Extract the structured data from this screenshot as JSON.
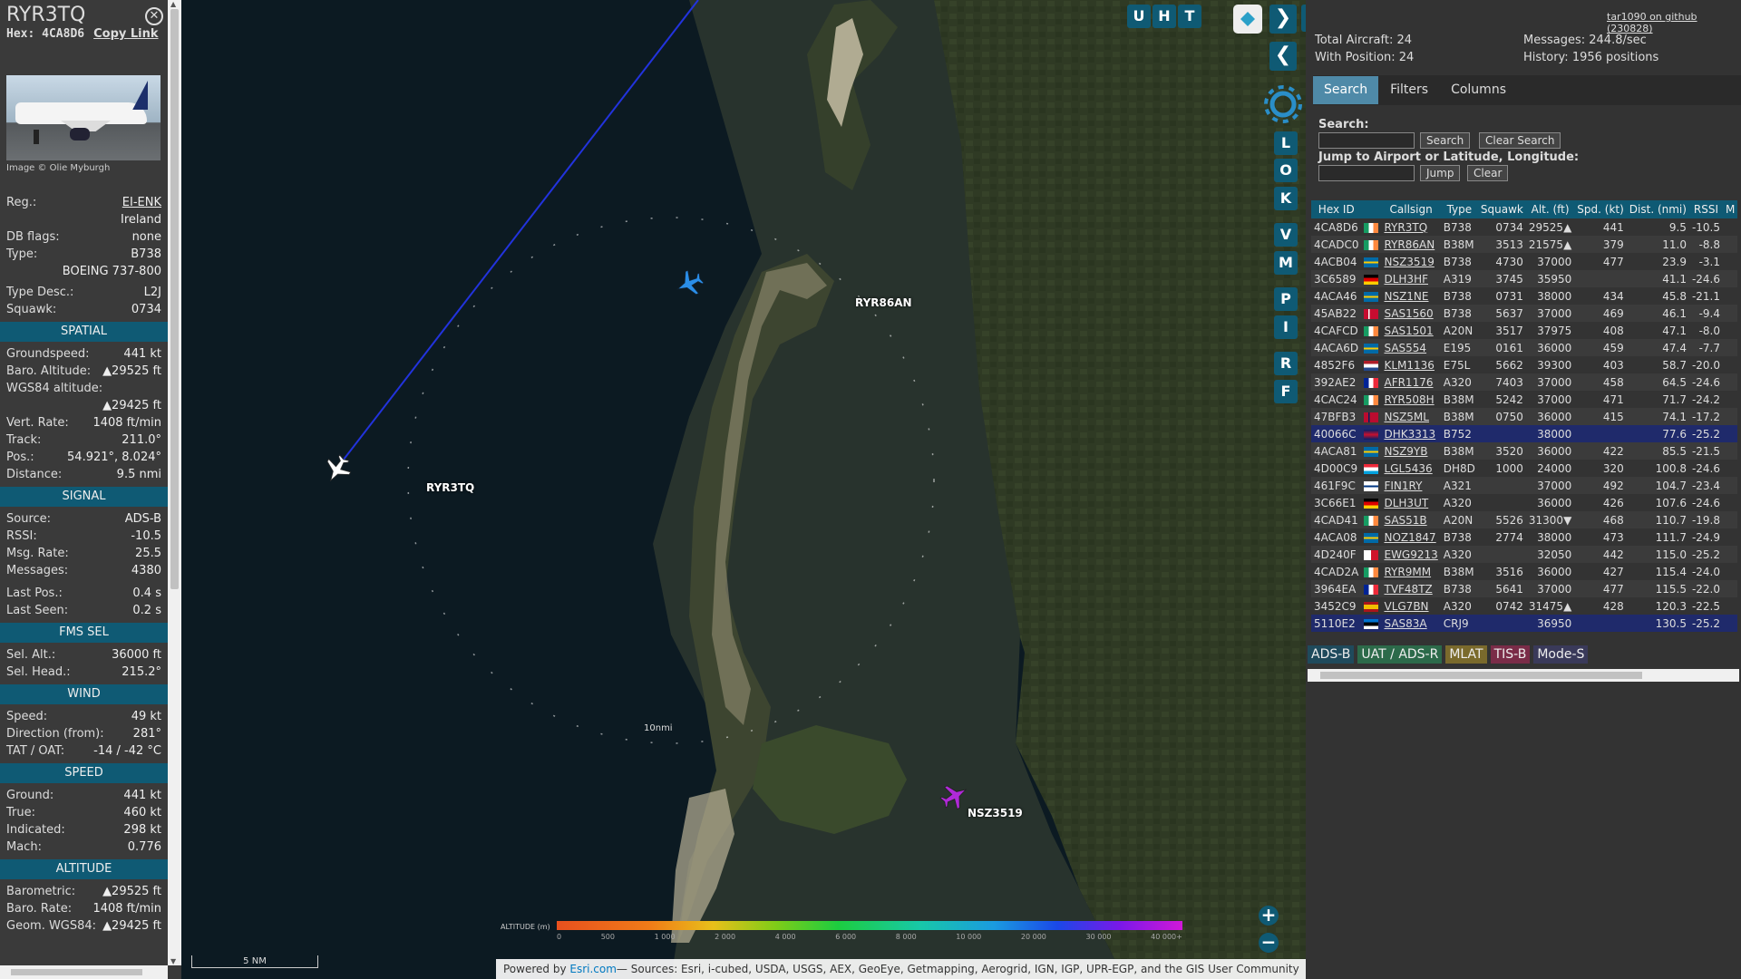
{
  "infoblock": {
    "callsign": "RYR3TQ",
    "close_icon": "close-icon",
    "hex_label": "Hex:",
    "hex": "4CA8D6",
    "copy_link": "Copy Link",
    "image_credit": "Image © Olie Myburgh",
    "reg_label": "Reg.:",
    "reg": "EI-ENK",
    "country": "Ireland",
    "dbflags_label": "DB flags:",
    "dbflags": "none",
    "type_label": "Type:",
    "type": "B738",
    "type_full": "BOEING 737-800",
    "typedesc_label": "Type Desc.:",
    "typedesc": "L2J",
    "squawk_label": "Squawk:",
    "squawk": "0734",
    "spatial_header": "SPATIAL",
    "gs_label": "Groundspeed:",
    "gs": "441 kt",
    "baro_label": "Baro. Altitude:",
    "baro": "▲29525 ft",
    "wgs_label": "WGS84 altitude:",
    "wgs": "▲29425 ft",
    "vr_label": "Vert. Rate:",
    "vr": "1408 ft/min",
    "track_label": "Track:",
    "track": "211.0°",
    "pos_label": "Pos.:",
    "pos": "54.921°, 8.024°",
    "dist_label": "Distance:",
    "dist": "9.5 nmi",
    "signal_header": "SIGNAL",
    "source_label": "Source:",
    "source": "ADS-B",
    "rssi_label": "RSSI:",
    "rssi": "-10.5",
    "msgrate_label": "Msg. Rate:",
    "msgrate": "25.5",
    "messages_label": "Messages:",
    "messages": "4380",
    "lastpos_label": "Last Pos.:",
    "lastpos": "0.4 s",
    "lastseen_label": "Last Seen:",
    "lastseen": "0.2 s",
    "fms_header": "FMS SEL",
    "selalt_label": "Sel. Alt.:",
    "selalt": "36000 ft",
    "selhead_label": "Sel. Head.:",
    "selhead": "215.2°",
    "wind_header": "WIND",
    "wspeed_label": "Speed:",
    "wspeed": "49 kt",
    "wdir_label": "Direction (from):",
    "wdir": "281°",
    "tat_label": "TAT / OAT:",
    "tat": "-14 / -42 °C",
    "speed_header": "SPEED",
    "ground_label": "Ground:",
    "ground": "441 kt",
    "true_label": "True:",
    "true": "460 kt",
    "ind_label": "Indicated:",
    "ind": "298 kt",
    "mach_label": "Mach:",
    "mach": "0.776",
    "alt_header": "ALTITUDE",
    "balt_label": "Barometric:",
    "balt": "▲29525 ft",
    "brate_label": "Baro. Rate:",
    "brate": "1408 ft/min",
    "geom_label": "Geom. WGS84:",
    "geom": "▲29425 ft"
  },
  "map": {
    "buttons_top": [
      "U",
      "H",
      "T"
    ],
    "side_buttons": [
      "L",
      "O",
      "K",
      "V",
      "M",
      "P",
      "I",
      "R",
      "F"
    ],
    "aircraft": [
      {
        "label": "RYR3TQ",
        "color": "#ffffff",
        "icon": "airplane-icon"
      },
      {
        "label": "RYR86AN",
        "color": "#2a8ee8",
        "icon": "airplane-icon"
      },
      {
        "label": "NSZ3519",
        "color": "#b02ad8",
        "icon": "airplane-icon"
      }
    ],
    "range_ring_label": "10nmi",
    "scale": "5 NM",
    "altitude_legend": {
      "title": "ALTITUDE (m)",
      "ticks": [
        "0",
        "500",
        "1 000",
        "2 000",
        "4 000",
        "6 000",
        "8 000",
        "10 000",
        "20 000",
        "30 000",
        "40 000+"
      ]
    },
    "attribution_prefix": "Powered by ",
    "attribution_link": "Esri.com",
    "attribution_rest": "— Sources: Esri, i-cubed, USDA, USGS, AEX, GeoEye, Getmapping, Aerogrid, IGN, IGP, UPR-EGP, and the GIS User Community",
    "zoom_in": "+",
    "zoom_out": "−"
  },
  "sidebar": {
    "github": "tar1090 on github (230828)",
    "total_aircraft": "Total Aircraft: 24",
    "with_position": "With Position: 24",
    "messages": "Messages: 244.8/sec",
    "history": "History: 1956 positions",
    "tabs": [
      "Search",
      "Filters",
      "Columns"
    ],
    "search_label": "Search:",
    "search_btn": "Search",
    "clear_search_btn": "Clear Search",
    "jump_label": "Jump to Airport or Latitude, Longitude:",
    "jump_btn": "Jump",
    "clear_btn": "Clear",
    "columns": [
      "Hex ID",
      "",
      "Callsign",
      "Type",
      "Squawk",
      "Alt. (ft)",
      "Spd. (kt)",
      "Dist. (nmi)",
      "RSSI",
      "M"
    ],
    "rows": [
      [
        "4CA8D6",
        "ie",
        "RYR3TQ",
        "B738",
        "0734",
        "29525▲",
        "441",
        "9.5",
        "-10.5"
      ],
      [
        "4CADC0",
        "ie",
        "RYR86AN",
        "B38M",
        "3513",
        "21575▲",
        "379",
        "11.0",
        "-8.8"
      ],
      [
        "4ACB04",
        "se",
        "NSZ3519",
        "B738",
        "4730",
        "37000",
        "477",
        "23.9",
        "-3.1"
      ],
      [
        "3C6589",
        "de",
        "DLH3HF",
        "A319",
        "3745",
        "35950",
        "",
        "41.1",
        "-24.6"
      ],
      [
        "4ACA46",
        "se",
        "NSZ1NE",
        "B738",
        "0731",
        "38000",
        "434",
        "45.8",
        "-21.1"
      ],
      [
        "45AB22",
        "dk",
        "SAS1560",
        "B738",
        "5637",
        "37000",
        "469",
        "46.1",
        "-9.4"
      ],
      [
        "4CAFCD",
        "ie",
        "SAS1501",
        "A20N",
        "3517",
        "37975",
        "408",
        "47.1",
        "-8.0"
      ],
      [
        "4ACA6D",
        "se",
        "SAS554",
        "E195",
        "0161",
        "36000",
        "459",
        "47.4",
        "-7.7"
      ],
      [
        "4852F6",
        "nl",
        "KLM1136",
        "E75L",
        "5662",
        "39300",
        "403",
        "58.7",
        "-20.0"
      ],
      [
        "392AE2",
        "fr",
        "AFR1176",
        "A320",
        "7403",
        "37000",
        "458",
        "64.5",
        "-24.6"
      ],
      [
        "4CAC24",
        "ie",
        "RYR508H",
        "B38M",
        "5242",
        "37000",
        "471",
        "71.7",
        "-24.2"
      ],
      [
        "47BFB3",
        "no",
        "NSZ5ML",
        "B38M",
        "0750",
        "36000",
        "415",
        "74.1",
        "-17.2"
      ],
      [
        "40066C",
        "gb",
        "DHK3313",
        "B752",
        "",
        "38000",
        "",
        "77.6",
        "-25.2"
      ],
      [
        "4ACA81",
        "se",
        "NSZ9YB",
        "B38M",
        "3520",
        "36000",
        "422",
        "85.5",
        "-21.5"
      ],
      [
        "4D00C9",
        "lu",
        "LGL5436",
        "DH8D",
        "1000",
        "24000",
        "320",
        "100.8",
        "-24.6"
      ],
      [
        "461F9C",
        "fi",
        "FIN1RY",
        "A321",
        "",
        "37000",
        "492",
        "104.7",
        "-23.4"
      ],
      [
        "3C66E1",
        "de",
        "DLH3UT",
        "A320",
        "",
        "36000",
        "426",
        "107.6",
        "-24.6"
      ],
      [
        "4CAD41",
        "ie",
        "SAS51B",
        "A20N",
        "5526",
        "31300▼",
        "468",
        "110.7",
        "-19.8"
      ],
      [
        "4ACA08",
        "se",
        "NOZ1847",
        "B738",
        "2774",
        "38000",
        "473",
        "111.7",
        "-24.9"
      ],
      [
        "4D240F",
        "mt",
        "EWG9213",
        "A320",
        "",
        "32050",
        "442",
        "115.0",
        "-25.2"
      ],
      [
        "4CAD2A",
        "ie",
        "RYR9MM",
        "B38M",
        "3516",
        "36000",
        "427",
        "115.4",
        "-24.0"
      ],
      [
        "3964EA",
        "fr",
        "TVF48TZ",
        "B738",
        "5641",
        "37000",
        "477",
        "115.5",
        "-22.0"
      ],
      [
        "3452C9",
        "es",
        "VLG7BN",
        "A320",
        "0742",
        "31475▲",
        "428",
        "120.3",
        "-22.5"
      ],
      [
        "5110E2",
        "ee",
        "SAS83A",
        "CRJ9",
        "",
        "36950",
        "",
        "130.5",
        "-25.2"
      ]
    ],
    "legend": [
      "ADS-B",
      "UAT / ADS-R",
      "MLAT",
      "TIS-B",
      "Mode-S"
    ]
  }
}
